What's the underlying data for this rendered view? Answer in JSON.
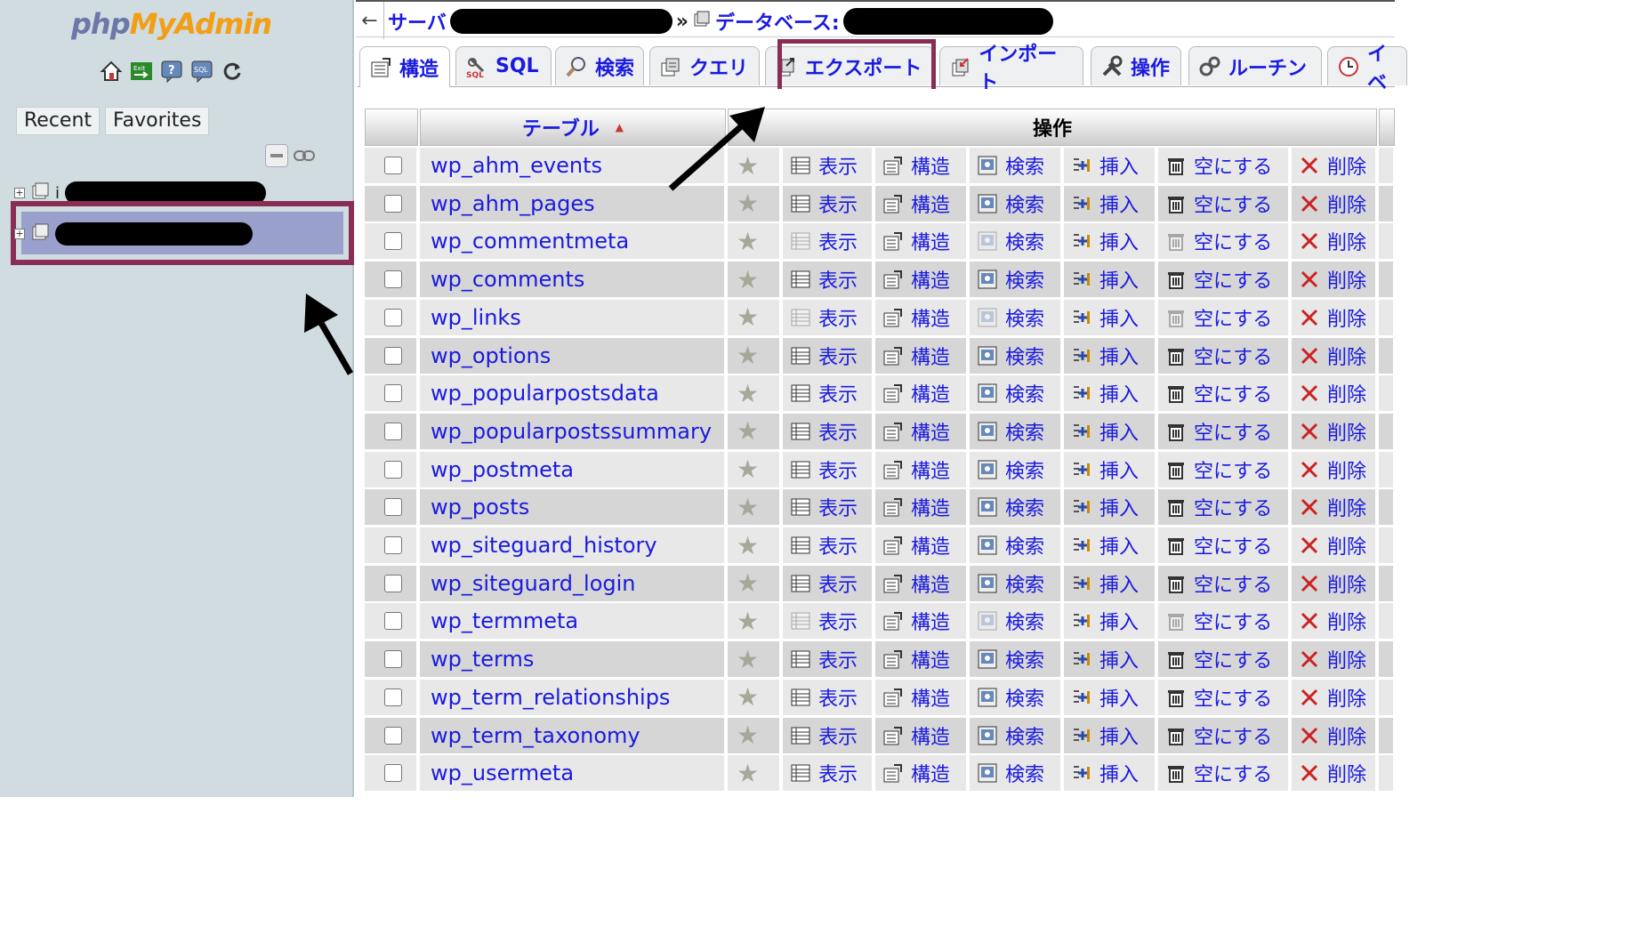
{
  "sidebar": {
    "logo": {
      "php": "php",
      "my": "My",
      "admin": "Admin"
    },
    "tabs": [
      "Recent",
      "Favorites"
    ],
    "nav_icons": [
      "home-icon",
      "exit-icon",
      "help-icon",
      "sql-icon",
      "reload-icon"
    ],
    "tree_ctrl_icons": [
      "collapse-all-icon",
      "link-icon"
    ],
    "tree": [
      {
        "prefix": "i",
        "redacted": true
      },
      {
        "prefix": "",
        "redacted": true,
        "selected": true
      }
    ]
  },
  "topbar": {
    "back": "←",
    "server_label": "サーバ",
    "sep": "»",
    "db_label": "データベース:"
  },
  "tabs": [
    {
      "label": "構造",
      "icon": "structure-icon",
      "active": true
    },
    {
      "label": "SQL",
      "icon": "sql-icon"
    },
    {
      "label": "検索",
      "icon": "search-icon"
    },
    {
      "label": "クエリ",
      "icon": "query-icon"
    },
    {
      "label": "エクスポート",
      "icon": "export-icon",
      "highlighted": true
    },
    {
      "label": "インポート",
      "icon": "import-icon"
    },
    {
      "label": "操作",
      "icon": "operations-icon"
    },
    {
      "label": "ルーチン",
      "icon": "routines-icon"
    },
    {
      "label": "イベ",
      "icon": "events-icon"
    }
  ],
  "table": {
    "header": {
      "table_col": "テーブル",
      "sort_icon": "▲",
      "ops_col": "操作"
    },
    "actions": {
      "browse": "表示",
      "structure": "構造",
      "search": "検索",
      "insert": "挿入",
      "empty": "空にする",
      "drop": "削除"
    },
    "rows": [
      {
        "name": "wp_ahm_events",
        "dim": false
      },
      {
        "name": "wp_ahm_pages",
        "dim": false
      },
      {
        "name": "wp_commentmeta",
        "dim": true
      },
      {
        "name": "wp_comments",
        "dim": false
      },
      {
        "name": "wp_links",
        "dim": true
      },
      {
        "name": "wp_options",
        "dim": false
      },
      {
        "name": "wp_popularpostsdata",
        "dim": false
      },
      {
        "name": "wp_popularpostssummary",
        "dim": false
      },
      {
        "name": "wp_postmeta",
        "dim": false
      },
      {
        "name": "wp_posts",
        "dim": false
      },
      {
        "name": "wp_siteguard_history",
        "dim": false
      },
      {
        "name": "wp_siteguard_login",
        "dim": false
      },
      {
        "name": "wp_termmeta",
        "dim": true
      },
      {
        "name": "wp_terms",
        "dim": false
      },
      {
        "name": "wp_term_relationships",
        "dim": false
      },
      {
        "name": "wp_term_taxonomy",
        "dim": false
      },
      {
        "name": "wp_usermeta",
        "dim": false
      }
    ]
  },
  "colors": {
    "link": "#1a1ae0",
    "highlight_box": "#8a2d55",
    "selected_db": "#9aa0cc",
    "sidebar_bg": "#d0dce0"
  }
}
